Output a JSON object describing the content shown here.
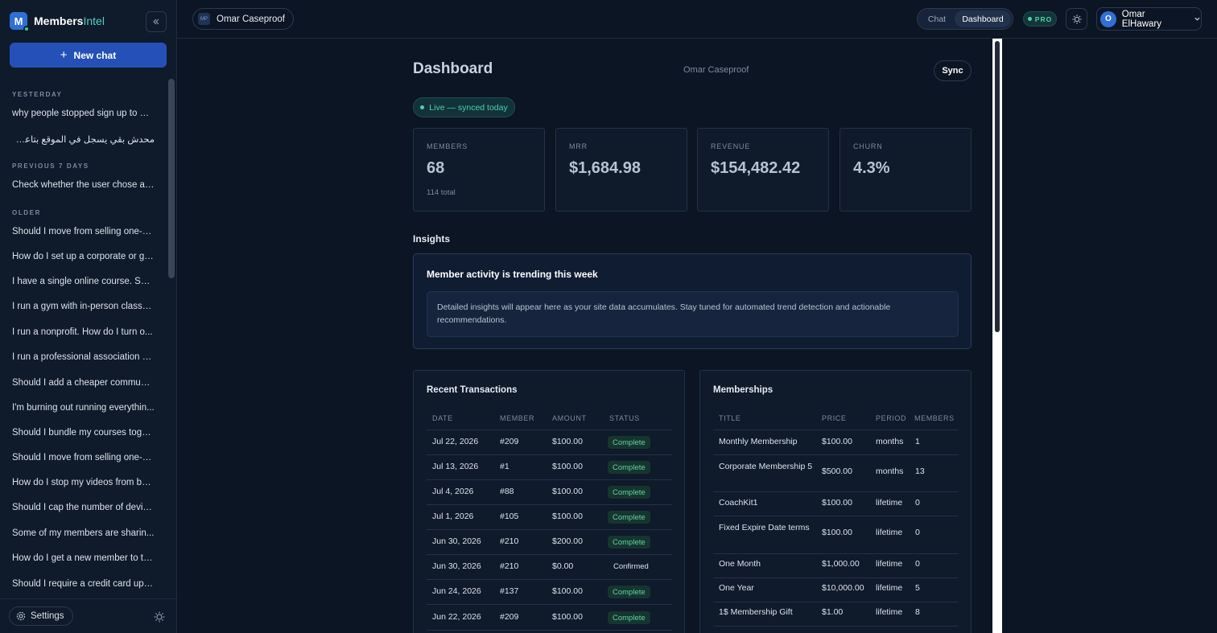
{
  "brand": {
    "logo_letter": "M",
    "name_main": "Members",
    "name_accent": "Intel"
  },
  "sidebar": {
    "new_chat_label": "New chat",
    "sections": [
      {
        "label": "YESTERDAY",
        "items": [
          "why people stopped sign up to m...",
          "محدش بقي يسجل في الموقع بتاعي مش فاهم"
        ]
      },
      {
        "label": "PREVIOUS 7 DAYS",
        "items": [
          "Check whether the user chose a v..."
        ]
      },
      {
        "label": "OLDER",
        "items": [
          "Should I move from selling one-o...",
          "How do I set up a corporate or gr...",
          "I have a single online course. Sho...",
          "I run a gym with in-person classe...",
          "I run a nonprofit. How do I turn o...",
          "I run a professional association w...",
          "Should I add a cheaper communi...",
          "I'm burning out running everythin...",
          "Should I bundle my courses toget...",
          "Should I move from selling one-o...",
          "How do I stop my videos from bei...",
          "Should I cap the number of devic...",
          "Some of my members are sharin...",
          "How do I get a new member to th...",
          "Should I require a credit card up f..."
        ]
      }
    ],
    "settings_label": "Settings"
  },
  "topbar": {
    "workspace_icon": "MP",
    "workspace_name": "Omar Caseproof",
    "tabs": [
      "Chat",
      "Dashboard"
    ],
    "active_tab": "Dashboard",
    "plan_badge": "PRO",
    "user_initial": "O",
    "user_name": "Omar ElHawary"
  },
  "dashboard": {
    "title": "Dashboard",
    "site_name": "Omar Caseproof",
    "sync_label": "Sync",
    "live_status": "Live — synced today",
    "stats": [
      {
        "label": "MEMBERS",
        "value": "68",
        "sub": "114 total"
      },
      {
        "label": "MRR",
        "value": "$1,684.98",
        "sub": ""
      },
      {
        "label": "REVENUE",
        "value": "$154,482.42",
        "sub": ""
      },
      {
        "label": "CHURN",
        "value": "4.3%",
        "sub": ""
      }
    ],
    "insights_heading": "Insights",
    "insight_title": "Member activity is trending this week",
    "insight_body": "Detailed insights will appear here as your site data accumulates. Stay tuned for automated trend detection and actionable recommendations.",
    "transactions": {
      "heading": "Recent Transactions",
      "columns": [
        "DATE",
        "MEMBER",
        "AMOUNT",
        "STATUS"
      ],
      "rows": [
        {
          "date": "Jul 22, 2026",
          "member": "#209",
          "amount": "$100.00",
          "status": "Complete"
        },
        {
          "date": "Jul 13, 2026",
          "member": "#1",
          "amount": "$100.00",
          "status": "Complete"
        },
        {
          "date": "Jul 4, 2026",
          "member": "#88",
          "amount": "$100.00",
          "status": "Complete"
        },
        {
          "date": "Jul 1, 2026",
          "member": "#105",
          "amount": "$100.00",
          "status": "Complete"
        },
        {
          "date": "Jun 30, 2026",
          "member": "#210",
          "amount": "$200.00",
          "status": "Complete"
        },
        {
          "date": "Jun 30, 2026",
          "member": "#210",
          "amount": "$0.00",
          "status": "Confirmed"
        },
        {
          "date": "Jun 24, 2026",
          "member": "#137",
          "amount": "$100.00",
          "status": "Complete"
        },
        {
          "date": "Jun 22, 2026",
          "member": "#209",
          "amount": "$100.00",
          "status": "Complete"
        }
      ]
    },
    "memberships": {
      "heading": "Memberships",
      "columns": [
        "TITLE",
        "PRICE",
        "PERIOD",
        "MEMBERS"
      ],
      "rows": [
        {
          "title": "Monthly Membership",
          "price": "$100.00",
          "period": "months",
          "members": "1"
        },
        {
          "title": "Corporate Membership 5",
          "price": "$500.00",
          "period": "months",
          "members": "13"
        },
        {
          "title": "CoachKit1",
          "price": "$100.00",
          "period": "lifetime",
          "members": "0"
        },
        {
          "title": "Fixed Expire Date terms",
          "price": "$100.00",
          "period": "lifetime",
          "members": "0"
        },
        {
          "title": "One Month",
          "price": "$1,000.00",
          "period": "lifetime",
          "members": "0"
        },
        {
          "title": "One Year",
          "price": "$10,000.00",
          "period": "lifetime",
          "members": "5"
        },
        {
          "title": "1$ Membership Gift",
          "price": "$1.00",
          "period": "lifetime",
          "members": "8"
        }
      ]
    }
  },
  "colors": {
    "background": "#0c1523",
    "accent": "#2550b8",
    "success": "#4fd0a8"
  }
}
